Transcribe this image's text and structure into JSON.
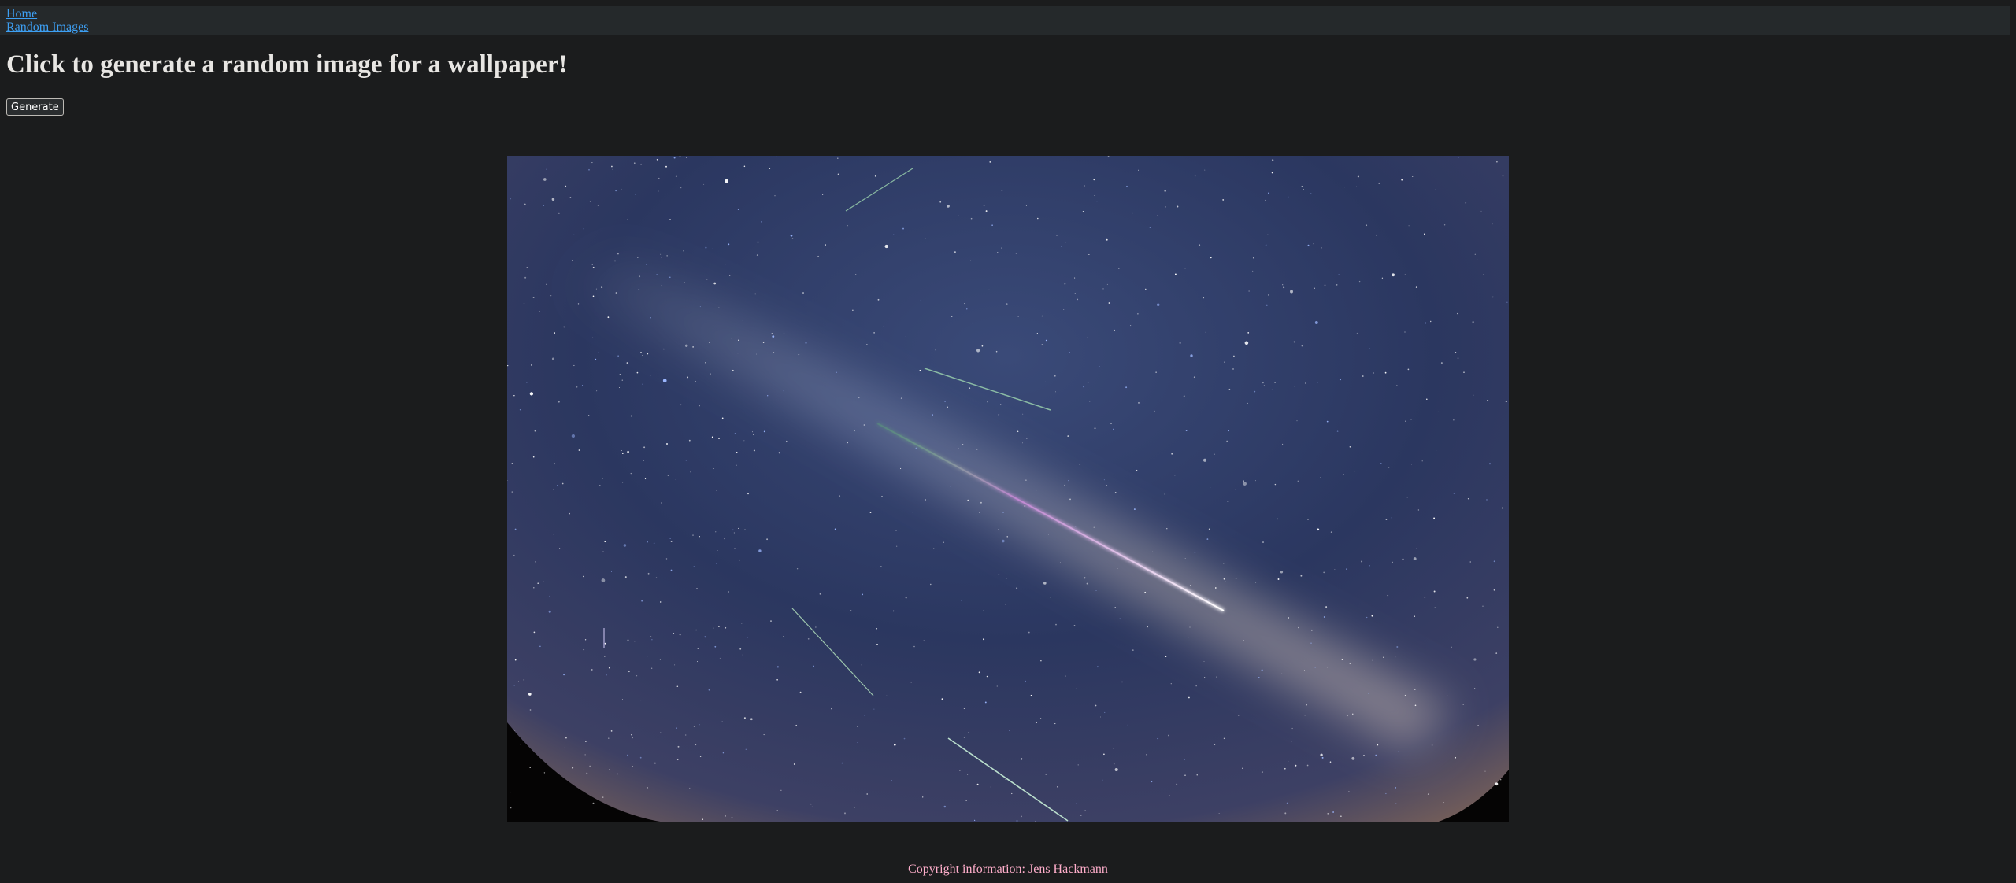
{
  "nav": {
    "home_label": "Home",
    "random_images_label": "Random Images"
  },
  "page": {
    "heading": "Click to generate a random image for a wallpaper!",
    "generate_button_label": "Generate"
  },
  "image": {
    "description": "Night sky fisheye photo of the Milky Way with meteor streaks",
    "icon": "night-sky-photo"
  },
  "footer": {
    "copyright_text": "Copyright information: Jens Hackmann"
  },
  "colors": {
    "background": "#1b1c1d",
    "nav_background": "#25292b",
    "link": "#3d9ff3",
    "heading": "#e8e6e3",
    "copyright": "#ffaecb"
  }
}
